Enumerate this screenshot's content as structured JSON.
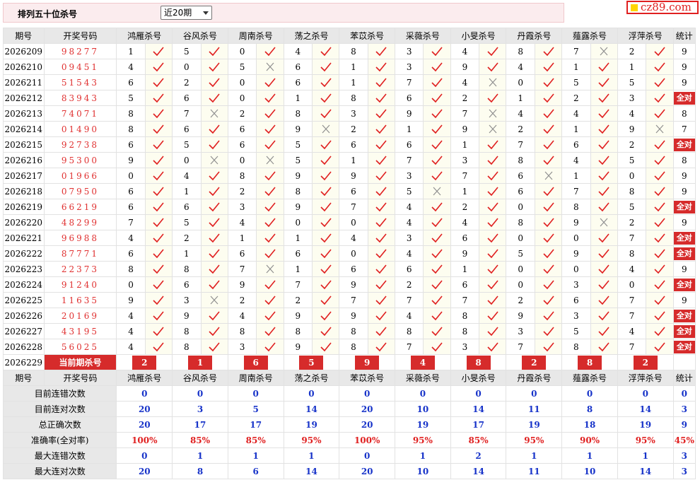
{
  "page": {
    "title": "排列五十位杀号",
    "period_select": "近20期",
    "logo_text": "cz89.com"
  },
  "headers": [
    "期号",
    "开奖号码",
    "鸿雁杀号",
    "谷风杀号",
    "周南杀号",
    "荡之杀号",
    "苯苡杀号",
    "采薇杀号",
    "小旻杀号",
    "丹霞杀号",
    "薤露杀号",
    "浮萍杀号",
    "统计"
  ],
  "rows": [
    {
      "period": "2026209",
      "draw": "98277",
      "kills": [
        1,
        5,
        0,
        4,
        8,
        3,
        4,
        8,
        7,
        2
      ],
      "results": [
        1,
        1,
        1,
        1,
        1,
        1,
        1,
        1,
        0,
        1
      ],
      "total": "9"
    },
    {
      "period": "2026210",
      "draw": "09451",
      "kills": [
        4,
        0,
        5,
        6,
        1,
        3,
        9,
        4,
        1,
        1
      ],
      "results": [
        1,
        1,
        0,
        1,
        1,
        1,
        1,
        1,
        1,
        1
      ],
      "total": "9"
    },
    {
      "period": "2026211",
      "draw": "51543",
      "kills": [
        6,
        2,
        0,
        6,
        1,
        7,
        4,
        0,
        5,
        5
      ],
      "results": [
        1,
        1,
        1,
        1,
        1,
        1,
        0,
        1,
        1,
        1
      ],
      "total": "9"
    },
    {
      "period": "2026212",
      "draw": "83943",
      "kills": [
        5,
        6,
        0,
        1,
        8,
        6,
        2,
        1,
        2,
        3
      ],
      "results": [
        1,
        1,
        1,
        1,
        1,
        1,
        1,
        1,
        1,
        1
      ],
      "total": "全对"
    },
    {
      "period": "2026213",
      "draw": "74071",
      "kills": [
        8,
        7,
        2,
        8,
        3,
        9,
        7,
        4,
        4,
        4
      ],
      "results": [
        1,
        0,
        1,
        1,
        1,
        1,
        0,
        1,
        1,
        1
      ],
      "total": "8"
    },
    {
      "period": "2026214",
      "draw": "01490",
      "kills": [
        8,
        6,
        6,
        9,
        2,
        1,
        9,
        2,
        1,
        9
      ],
      "results": [
        1,
        1,
        1,
        0,
        1,
        1,
        0,
        1,
        1,
        0
      ],
      "total": "7"
    },
    {
      "period": "2026215",
      "draw": "92738",
      "kills": [
        6,
        5,
        6,
        5,
        6,
        6,
        1,
        7,
        6,
        2
      ],
      "results": [
        1,
        1,
        1,
        1,
        1,
        1,
        1,
        1,
        1,
        1
      ],
      "total": "全对"
    },
    {
      "period": "2026216",
      "draw": "95300",
      "kills": [
        9,
        0,
        0,
        5,
        1,
        7,
        3,
        8,
        4,
        5
      ],
      "results": [
        1,
        0,
        0,
        1,
        1,
        1,
        1,
        1,
        1,
        1
      ],
      "total": "8"
    },
    {
      "period": "2026217",
      "draw": "01966",
      "kills": [
        0,
        4,
        8,
        9,
        9,
        3,
        7,
        6,
        1,
        0
      ],
      "results": [
        1,
        1,
        1,
        1,
        1,
        1,
        1,
        0,
        1,
        1
      ],
      "total": "9"
    },
    {
      "period": "2026218",
      "draw": "07950",
      "kills": [
        6,
        1,
        2,
        8,
        6,
        5,
        1,
        6,
        7,
        8
      ],
      "results": [
        1,
        1,
        1,
        1,
        1,
        0,
        1,
        1,
        1,
        1
      ],
      "total": "9"
    },
    {
      "period": "2026219",
      "draw": "66219",
      "kills": [
        6,
        6,
        3,
        9,
        7,
        4,
        2,
        0,
        8,
        5
      ],
      "results": [
        1,
        1,
        1,
        1,
        1,
        1,
        1,
        1,
        1,
        1
      ],
      "total": "全对"
    },
    {
      "period": "2026220",
      "draw": "48299",
      "kills": [
        7,
        5,
        4,
        0,
        0,
        4,
        4,
        8,
        9,
        2
      ],
      "results": [
        1,
        1,
        1,
        1,
        1,
        1,
        1,
        1,
        0,
        1
      ],
      "total": "9"
    },
    {
      "period": "2026221",
      "draw": "96988",
      "kills": [
        4,
        2,
        1,
        1,
        4,
        3,
        6,
        0,
        0,
        7
      ],
      "results": [
        1,
        1,
        1,
        1,
        1,
        1,
        1,
        1,
        1,
        1
      ],
      "total": "全对"
    },
    {
      "period": "2026222",
      "draw": "87771",
      "kills": [
        6,
        1,
        6,
        6,
        0,
        4,
        9,
        5,
        9,
        8
      ],
      "results": [
        1,
        1,
        1,
        1,
        1,
        1,
        1,
        1,
        1,
        1
      ],
      "total": "全对"
    },
    {
      "period": "2026223",
      "draw": "22373",
      "kills": [
        8,
        8,
        7,
        1,
        6,
        6,
        1,
        0,
        0,
        4
      ],
      "results": [
        1,
        1,
        0,
        1,
        1,
        1,
        1,
        1,
        1,
        1
      ],
      "total": "9"
    },
    {
      "period": "2026224",
      "draw": "91240",
      "kills": [
        0,
        6,
        9,
        7,
        9,
        2,
        6,
        0,
        3,
        0
      ],
      "results": [
        1,
        1,
        1,
        1,
        1,
        1,
        1,
        1,
        1,
        1
      ],
      "total": "全对"
    },
    {
      "period": "2026225",
      "draw": "11635",
      "kills": [
        9,
        3,
        2,
        2,
        7,
        7,
        7,
        2,
        6,
        7
      ],
      "results": [
        1,
        0,
        1,
        1,
        1,
        1,
        1,
        1,
        1,
        1
      ],
      "total": "9"
    },
    {
      "period": "2026226",
      "draw": "20169",
      "kills": [
        4,
        9,
        4,
        9,
        9,
        4,
        8,
        9,
        3,
        7
      ],
      "results": [
        1,
        1,
        1,
        1,
        1,
        1,
        1,
        1,
        1,
        1
      ],
      "total": "全对"
    },
    {
      "period": "2026227",
      "draw": "43195",
      "kills": [
        4,
        8,
        8,
        8,
        8,
        8,
        8,
        3,
        5,
        4
      ],
      "results": [
        1,
        1,
        1,
        1,
        1,
        1,
        1,
        1,
        1,
        1
      ],
      "total": "全对"
    },
    {
      "period": "2026228",
      "draw": "56025",
      "kills": [
        4,
        8,
        3,
        9,
        8,
        7,
        3,
        7,
        8,
        7
      ],
      "results": [
        1,
        1,
        1,
        1,
        1,
        1,
        1,
        1,
        1,
        1
      ],
      "total": "全对"
    }
  ],
  "current": {
    "period": "2026229",
    "label": "当前期杀号",
    "kills": [
      2,
      1,
      6,
      5,
      9,
      4,
      8,
      2,
      8,
      2
    ]
  },
  "stats": [
    {
      "label": "目前连错次数",
      "values": [
        "0",
        "0",
        "0",
        "0",
        "0",
        "0",
        "0",
        "0",
        "0",
        "0",
        "0"
      ]
    },
    {
      "label": "目前连对次数",
      "values": [
        "20",
        "3",
        "5",
        "14",
        "20",
        "10",
        "14",
        "11",
        "8",
        "14",
        "3"
      ]
    },
    {
      "label": "总正确次数",
      "values": [
        "20",
        "17",
        "17",
        "19",
        "20",
        "19",
        "17",
        "19",
        "18",
        "19",
        "9"
      ]
    },
    {
      "label": "准确率(全对率)",
      "values": [
        "100%",
        "85%",
        "85%",
        "95%",
        "100%",
        "95%",
        "85%",
        "95%",
        "90%",
        "95%",
        "45%"
      ]
    },
    {
      "label": "最大连错次数",
      "values": [
        "0",
        "1",
        "1",
        "1",
        "0",
        "1",
        "2",
        "1",
        "1",
        "1",
        "3"
      ]
    },
    {
      "label": "最大连对次数",
      "values": [
        "20",
        "8",
        "6",
        "14",
        "20",
        "10",
        "14",
        "11",
        "10",
        "14",
        "3"
      ]
    }
  ],
  "colors": {
    "check": "#e02020",
    "cross": "#909090",
    "full_badge": "#d62b2b",
    "stat_blue": "#1733c9"
  }
}
